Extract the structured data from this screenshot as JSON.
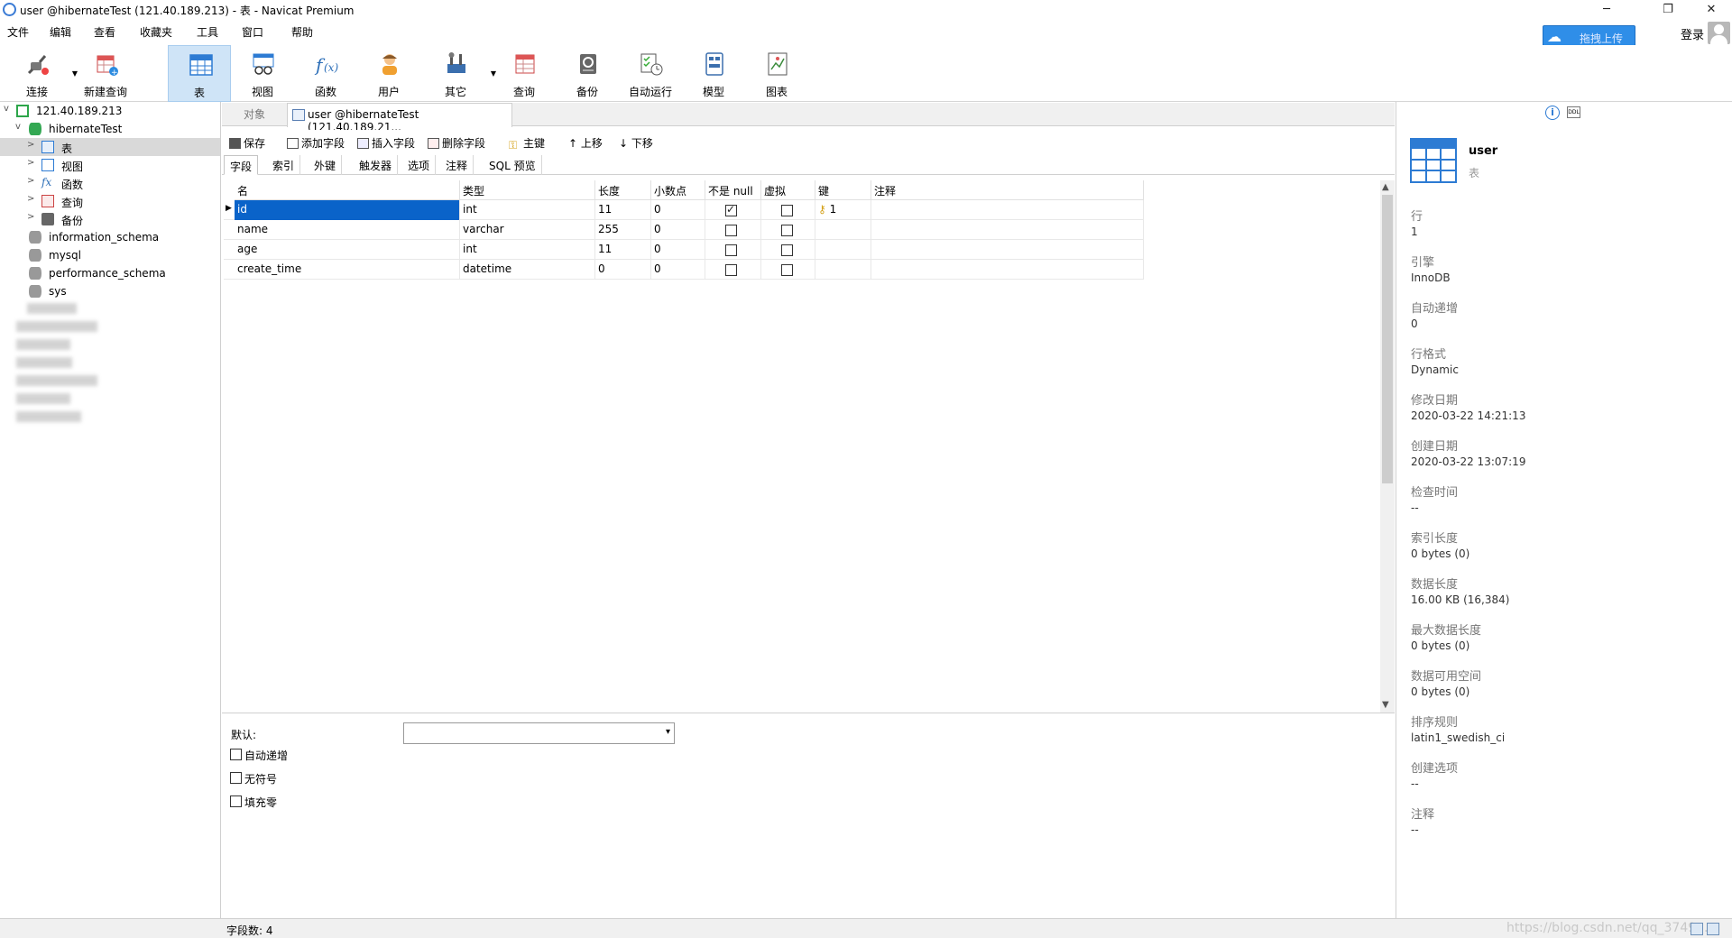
{
  "window": {
    "title": "user @hibernateTest (121.40.189.213) - 表 - Navicat Premium",
    "controls": {
      "minimize": "─",
      "restore": "❐",
      "close": "✕"
    }
  },
  "menu": [
    "文件",
    "编辑",
    "查看",
    "收藏夹",
    "工具",
    "窗口",
    "帮助"
  ],
  "top_right": {
    "upload_label": "拖拽上传",
    "login_label": "登录"
  },
  "toolbar": [
    {
      "label": "连接",
      "icon": "plug-icon"
    },
    {
      "label": "新建查询",
      "icon": "new-query-icon"
    },
    {
      "label": "表",
      "icon": "table-icon"
    },
    {
      "label": "视图",
      "icon": "view-icon"
    },
    {
      "label": "函数",
      "icon": "function-icon"
    },
    {
      "label": "用户",
      "icon": "user-icon"
    },
    {
      "label": "其它",
      "icon": "tools-icon"
    },
    {
      "label": "查询",
      "icon": "query-icon"
    },
    {
      "label": "备份",
      "icon": "backup-icon"
    },
    {
      "label": "自动运行",
      "icon": "automation-icon"
    },
    {
      "label": "模型",
      "icon": "model-icon"
    },
    {
      "label": "图表",
      "icon": "chart-icon"
    }
  ],
  "sidebar": {
    "connection": "121.40.189.213",
    "database": "hibernateTest",
    "db_children": [
      "表",
      "视图",
      "函数",
      "查询",
      "备份"
    ],
    "other_dbs": [
      "information_schema",
      "mysql",
      "performance_schema",
      "sys"
    ]
  },
  "tabs": {
    "objects": "对象",
    "current": "user @hibernateTest (121.40.189.21..."
  },
  "actions": [
    "保存",
    "添加字段",
    "插入字段",
    "删除字段",
    "主键",
    "上移",
    "下移"
  ],
  "subtabs": [
    "字段",
    "索引",
    "外键",
    "触发器",
    "选项",
    "注释",
    "SQL 预览"
  ],
  "grid": {
    "headers": [
      "名",
      "类型",
      "长度",
      "小数点",
      "不是 null",
      "虚拟",
      "键",
      "注释"
    ],
    "rows": [
      {
        "name": "id",
        "type": "int",
        "length": "11",
        "decimals": "0",
        "not_null": true,
        "virtual": false,
        "key": "1",
        "comment": ""
      },
      {
        "name": "name",
        "type": "varchar",
        "length": "255",
        "decimals": "0",
        "not_null": false,
        "virtual": false,
        "key": "",
        "comment": ""
      },
      {
        "name": "age",
        "type": "int",
        "length": "11",
        "decimals": "0",
        "not_null": false,
        "virtual": false,
        "key": "",
        "comment": ""
      },
      {
        "name": "create_time",
        "type": "datetime",
        "length": "0",
        "decimals": "0",
        "not_null": false,
        "virtual": false,
        "key": "",
        "comment": ""
      }
    ]
  },
  "field_props": {
    "default_label": "默认:",
    "default_value": "",
    "auto_increment": "自动递增",
    "unsigned": "无符号",
    "zerofill": "填充零"
  },
  "status": {
    "field_count": "字段数: 4",
    "watermark": "https://blog.csdn.net/qq_3749..."
  },
  "info": {
    "name": "user",
    "kind": "表",
    "items": [
      {
        "k": "行",
        "v": "1"
      },
      {
        "k": "引擎",
        "v": "InnoDB"
      },
      {
        "k": "自动递增",
        "v": "0"
      },
      {
        "k": "行格式",
        "v": "Dynamic"
      },
      {
        "k": "修改日期",
        "v": "2020-03-22 14:21:13"
      },
      {
        "k": "创建日期",
        "v": "2020-03-22 13:07:19"
      },
      {
        "k": "检查时间",
        "v": "--"
      },
      {
        "k": "索引长度",
        "v": "0 bytes (0)"
      },
      {
        "k": "数据长度",
        "v": "16.00 KB (16,384)"
      },
      {
        "k": "最大数据长度",
        "v": "0 bytes (0)"
      },
      {
        "k": "数据可用空间",
        "v": "0 bytes (0)"
      },
      {
        "k": "排序规则",
        "v": "latin1_swedish_ci"
      },
      {
        "k": "创建选项",
        "v": "--"
      },
      {
        "k": "注释",
        "v": "--"
      }
    ]
  }
}
